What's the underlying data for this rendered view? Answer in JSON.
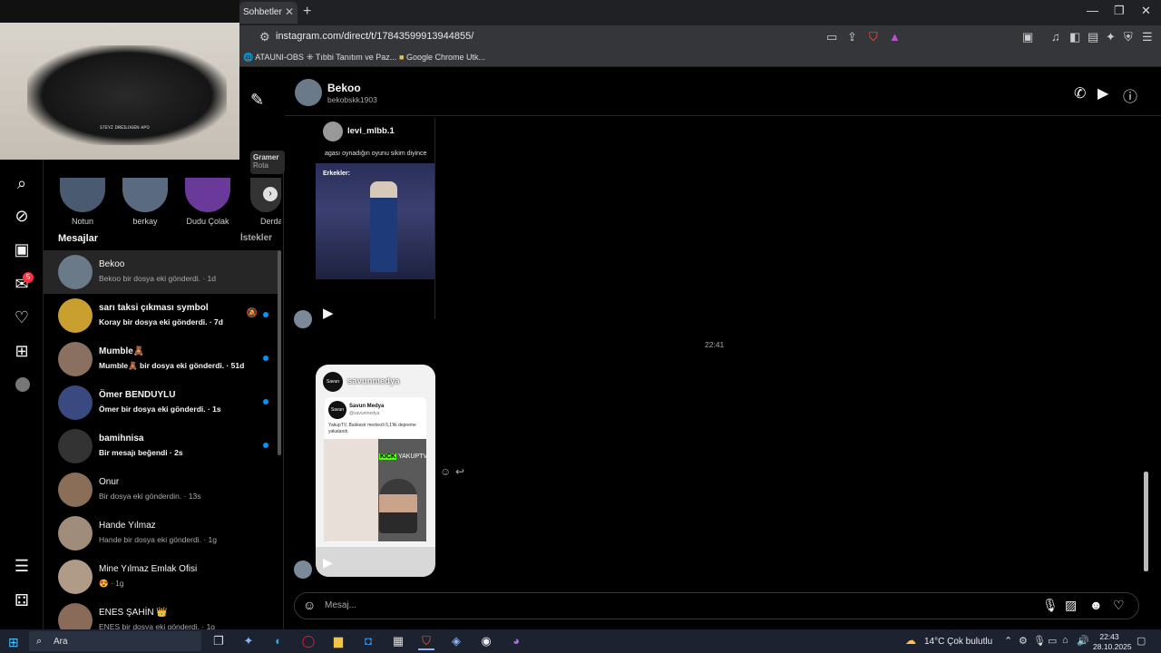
{
  "browser": {
    "tab_title": "Sohbetler",
    "tab_close": "✕",
    "new_tab": "+",
    "url": "instagram.com/direct/t/17843599913944855/",
    "bookmarks": [
      "ATAUNI-OBS",
      "Tıbbi Tanıtım ve Paz...",
      "Google Chrome Utk..."
    ],
    "window_controls": [
      "—",
      "❐",
      "✕"
    ]
  },
  "webcam": {
    "caption": "ꜱᴛᴇʏᴢ ᴅʀᴇɪʟᴏɢᴇɴ ᴀᴘᴏ"
  },
  "nav": {
    "notification_count": "5"
  },
  "stories": [
    {
      "name": "Notun"
    },
    {
      "name": "berkay"
    },
    {
      "name": "Dudu Çolak"
    },
    {
      "name": "Derda"
    }
  ],
  "gramer": {
    "line1": "Gramer",
    "line2": "Rota"
  },
  "list": {
    "title": "Mesajlar",
    "requests": "İstekler",
    "conversations": [
      {
        "name": "Bekoo",
        "preview": "Bekoo bir dosya eki gönderdi. · 1d",
        "unread": false,
        "color": "#6b7a88"
      },
      {
        "name": "sarı taksi çıkması symbol",
        "preview": "Koray bir dosya eki gönderdi. · 7d",
        "unread": true,
        "muted": true,
        "color": "#c9a030"
      },
      {
        "name": "Mumble🧸",
        "preview": "Mumble🧸 bir dosya eki gönderdi. · 51d",
        "unread": true,
        "color": "#8a7060"
      },
      {
        "name": "Ömer BENDUYLU",
        "preview": "Ömer bir dosya eki gönderdi. · 1s",
        "unread": true,
        "color": "#3a4a80"
      },
      {
        "name": "bamihnisa",
        "preview": "Bir mesajı beğendi · 2s",
        "unread": true,
        "color": "#333333"
      },
      {
        "name": "Onur",
        "preview": "Bir dosya eki gönderdin. · 13s",
        "unread": false,
        "color": "#8a6e58"
      },
      {
        "name": "Hande Yılmaz",
        "preview": "Hande bir dosya eki gönderdi. · 1g",
        "unread": false,
        "color": "#a08c7a"
      },
      {
        "name": "Mine Yılmaz Emlak Ofisi",
        "preview": "😍 · 1g",
        "unread": false,
        "color": "#b09a88"
      },
      {
        "name": "ENES ŞAHİN 👑",
        "preview": "ENES bir dosya eki gönderdi. · 1g",
        "unread": false,
        "color": "#8a6a58"
      }
    ]
  },
  "chat": {
    "name": "Bekoo",
    "username": "bekobskk1903",
    "shared_post": {
      "username": "levi_mlbb.1",
      "caption": "agası oynadığın oyunu sikim diyince",
      "image_caption": "Erkekler:"
    },
    "timestamp": "22:41",
    "shared_reel": {
      "handle": "savunmedya",
      "logo_text": "Savun",
      "inner_name": "Savun Medya",
      "inner_user": "@savunmedya",
      "inner_text": "YakupTV, Balıkesir merkezli 6,1'lik depreme yakalandı.",
      "stream_tag": "KICK",
      "stream_name": "YAKUPTV_"
    },
    "composer_placeholder": "Mesaj..."
  },
  "taskbar": {
    "search": "Ara",
    "weather": "14°C  Çok bulutlu",
    "time": "22:43",
    "date": "28.10.2025"
  }
}
